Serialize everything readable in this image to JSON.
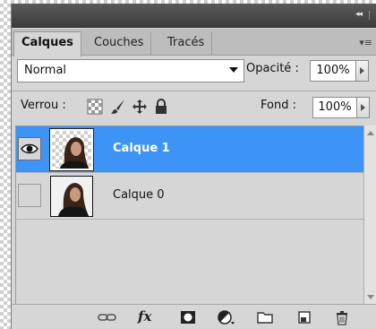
{
  "panel": {
    "tabs": [
      {
        "label": "Calques",
        "active": true
      },
      {
        "label": "Couches",
        "active": false
      },
      {
        "label": "Tracés",
        "active": false
      }
    ],
    "collapse_glyph": "◂◂",
    "menu_glyph": "▾≡"
  },
  "blend": {
    "mode": "Normal",
    "opacity_label": "Opacité :",
    "opacity_value": "100%"
  },
  "lock": {
    "label": "Verrou :",
    "icons": [
      "lock-transparent-icon",
      "lock-brush-icon",
      "lock-move-icon",
      "lock-all-icon"
    ],
    "fill_label": "Fond :",
    "fill_value": "100%"
  },
  "layers": [
    {
      "name": "Calque 1",
      "visible": true,
      "selected": true,
      "transparent_bg": true
    },
    {
      "name": "Calque 0",
      "visible": false,
      "selected": false,
      "transparent_bg": false
    }
  ],
  "bottom_icons": [
    "link-icon",
    "fx-icon",
    "mask-icon",
    "adjustment-icon",
    "group-folder-icon",
    "new-layer-icon",
    "trash-icon"
  ],
  "fx_label": "fx",
  "colors": {
    "selection": "#3d94f6",
    "panel_bg": "#d6d6d6",
    "titlebar": "#4a4a4a"
  }
}
